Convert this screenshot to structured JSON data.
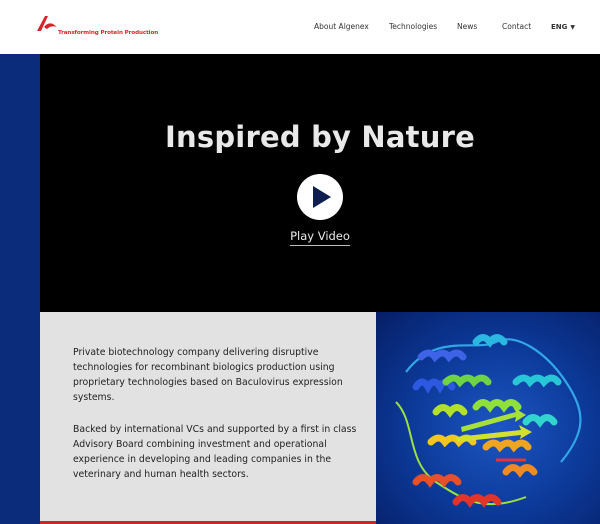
{
  "header": {
    "logo_alt": "Algenex",
    "tagline": "Transforming Protein Production",
    "nav": {
      "about": "About Algenex",
      "technologies": "Technologies",
      "news": "News",
      "contact": "Contact",
      "language": "ENG",
      "language_caret": "▼"
    }
  },
  "hero": {
    "title": "Inspired by Nature",
    "play_label": "Play Video"
  },
  "info": {
    "paragraph1": "Private biotechnology company delivering disruptive technologies for recombinant biologics production using proprietary technologies based on Baculovirus expression systems.",
    "paragraph2": "Backed by international VCs and supported by a first in class Advisory Board combining investment and operational experience in developing and leading companies in the veterinary and human health sectors."
  },
  "colors": {
    "brand_red": "#d8232a",
    "brand_blue": "#0b2c7a",
    "hero_bg": "#000000",
    "panel_bg": "#e2e2e2"
  },
  "icons": {
    "logo": "algenex-logo-icon",
    "play": "play-icon",
    "caret": "chevron-down-icon"
  }
}
